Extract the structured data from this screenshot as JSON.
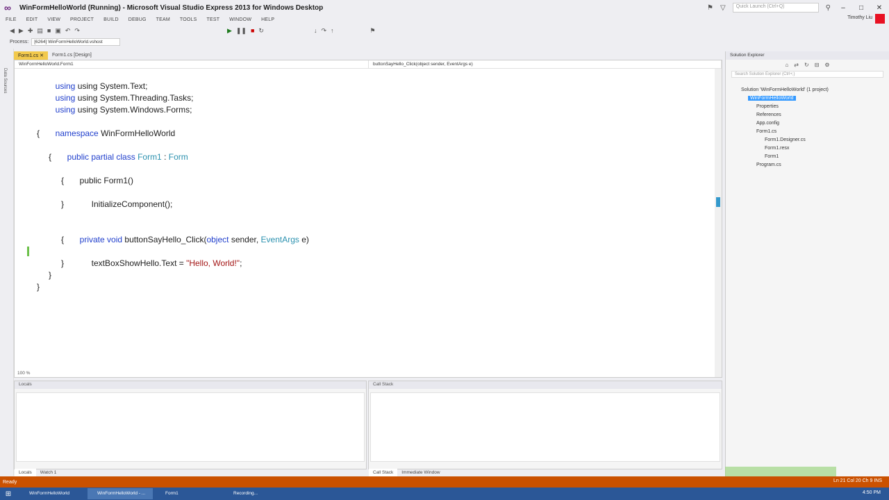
{
  "window": {
    "title": "WinFormHelloWorld (Running) - Microsoft Visual Studio Express 2013 for Windows Desktop",
    "quick_launch_placeholder": "Quick Launch (Ctrl+Q)"
  },
  "menu": {
    "items": [
      "FILE",
      "EDIT",
      "VIEW",
      "PROJECT",
      "BUILD",
      "DEBUG",
      "TEAM",
      "TOOLS",
      "TEST",
      "WINDOW",
      "HELP"
    ],
    "user": "Timothy Liu"
  },
  "toolbar2": {
    "process_label": "Process:",
    "process_value": "[6264] WinFormHelloWorld.vshost"
  },
  "rail": {
    "label": "Data Sources"
  },
  "tabs": [
    {
      "label": "Form1.cs ✕"
    },
    {
      "label": "Form1.cs [Design]"
    }
  ],
  "editor": {
    "nav_left": "WinFormHelloWorld.Form1",
    "nav_right": "buttonSayHello_Click(object sender, EventArgs e)",
    "zoom": "100 %"
  },
  "code": {
    "line1": "using System.Text;",
    "line2": "using System.Threading.Tasks;",
    "line3": "using System.Windows.Forms;",
    "ns_kw": "namespace",
    "ns_name": "WinFormHelloWorld",
    "class_kw": "public partial class",
    "class_name": "Form1",
    "class_base": "Form",
    "ctor": "public Form1()",
    "init": "InitializeComponent();",
    "method_kw": "private void",
    "method_name": "buttonSayHello_Click(",
    "param_kw": "object",
    "param_sender": "sender,",
    "param_type": "EventArgs",
    "param_e": "e)",
    "assign": "textBoxShowHello.Text = ",
    "string": "\"Hello, World!\"",
    "semicolon": ";"
  },
  "solution": {
    "title": "Solution Explorer",
    "search_placeholder": "Search Solution Explorer (Ctrl+;)",
    "items": [
      "Solution 'WinFormHelloWorld' (1 project)",
      "WinFormHelloWorld",
      "Properties",
      "References",
      "App.config",
      "Form1.cs",
      "Form1.Designer.cs",
      "Form1.resx",
      "Form1",
      "Program.cs"
    ]
  },
  "bottom": {
    "left_title": "Locals",
    "right_title": "Call Stack",
    "left_tabs": [
      "Locals",
      "Watch 1"
    ],
    "right_tabs": [
      "Call Stack",
      "Immediate Window"
    ]
  },
  "status": {
    "text": "Ready",
    "right": "Ln 21    Col 20    Ch 9    INS"
  },
  "taskbar": {
    "items": [
      "WinFormHelloWorld",
      "WinFormHelloWorld - ...",
      "Form1",
      "Recording..."
    ],
    "clock": "4:50 PM"
  }
}
